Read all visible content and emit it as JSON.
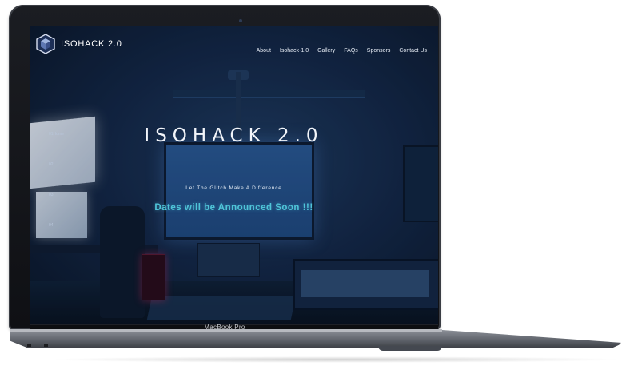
{
  "device": {
    "brand_label": "MacBook Pro"
  },
  "site": {
    "logo_text": "ISOHACK 2.0",
    "nav": [
      "About",
      "Isohack-1.0",
      "Gallery",
      "FAQs",
      "Sponsors",
      "Contact Us"
    ],
    "side_indicators": [
      "01Home",
      "02",
      "03",
      "04",
      "05"
    ],
    "hero": {
      "title": "ISOHACK 2.0",
      "tagline": "Let The Glitch Make A Difference",
      "dates_notice": "Dates will be Announced Soon !!!"
    },
    "colors": {
      "accent": "#4fc4d8",
      "background": "#14294a",
      "text": "#f2f5fa"
    }
  },
  "icons": {
    "logo": "hexagon-cube-logo-icon"
  }
}
